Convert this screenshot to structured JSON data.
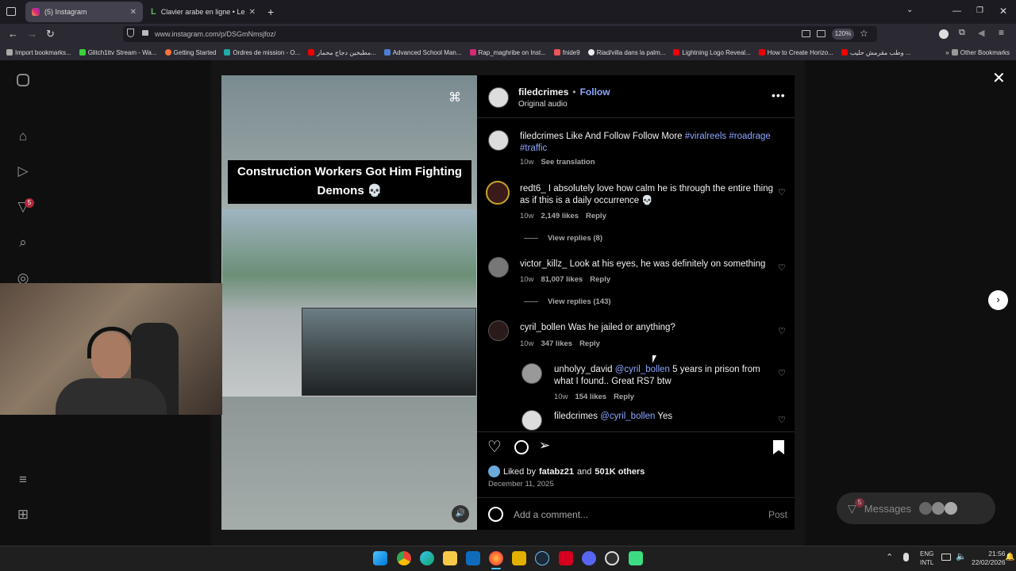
{
  "browser": {
    "tabs": [
      {
        "title": "(5) Instagram"
      },
      {
        "title": "Clavier arabe en ligne • Lexilogos"
      }
    ],
    "url": "www.instagram.com/p/DSGmNmsjfoz/",
    "zoom": "120%",
    "bookmarks": [
      "Import bookmarks...",
      "Glitch1ttv Stream - Wa...",
      "Getting Started",
      "Ordres de mission - O...",
      "مطبخين دجاج محمار...",
      "Advanced School Man...",
      "Rap_maghribe on Inst...",
      "fnide9",
      "Riad/villa dans la palm...",
      "Lightning Logo Reveal...",
      "How to Create Horizo...",
      "وطب مقرمش حليب ...",
      "Other Bookmarks"
    ]
  },
  "sidebar": {
    "notification_badge": "5"
  },
  "video": {
    "caption": "Construction Workers Got Him Fighting Demons 💀"
  },
  "post": {
    "author": "filedcrimes",
    "follow_label": "Follow",
    "audio": "Original audio",
    "more_icon": "more-icon",
    "caption_user": "filedcrimes",
    "caption_text": "Like And Follow Follow More",
    "hashtags": "#viralreels #roadrage #traffic",
    "caption_time": "10w",
    "see_translation": "See translation",
    "comments": [
      {
        "user": "redt6_",
        "text": "I absolutely love how calm he is through the entire thing as if this is a daily occurrence 💀",
        "time": "10w",
        "likes": "2,149 likes",
        "reply": "Reply",
        "view_replies": "View replies (8)"
      },
      {
        "user": "victor_killz_",
        "text": "Look at his eyes, he was definitely on something",
        "time": "10w",
        "likes": "81,007 likes",
        "reply": "Reply",
        "view_replies": "View replies (143)"
      },
      {
        "user": "cyril_bollen",
        "text": "Was he jailed or anything?",
        "time": "10w",
        "likes": "347 likes",
        "reply": "Reply"
      }
    ],
    "replies": [
      {
        "user": "unholyy_david",
        "mention": "@cyril_bollen",
        "text": "5 years in prison from what I found.. Great RS7 btw",
        "time": "10w",
        "likes": "154 likes",
        "reply": "Reply"
      },
      {
        "user": "filedcrimes",
        "mention": "@cyril_bollen",
        "text": "Yes"
      }
    ],
    "liked_by_prefix": "Liked by",
    "liked_by_user": "fatabz21",
    "liked_by_and": "and",
    "liked_by_others": "501K others",
    "date": "December 11, 2025",
    "comment_placeholder": "Add a comment...",
    "post_label": "Post"
  },
  "messages": {
    "label": "Messages",
    "badge": "5"
  },
  "taskbar": {
    "lang1": "ENG",
    "lang2": "INTL",
    "time": "21:56",
    "date": "22/02/2026"
  }
}
